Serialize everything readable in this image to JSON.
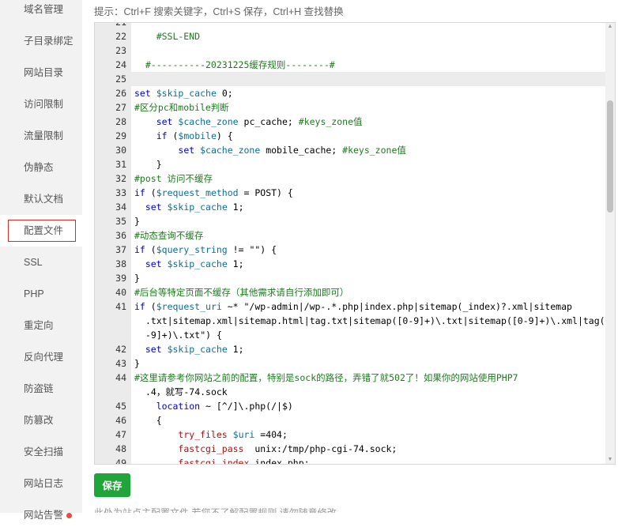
{
  "sidebar": {
    "items": [
      {
        "label": "域名管理"
      },
      {
        "label": "子目录绑定"
      },
      {
        "label": "网站目录"
      },
      {
        "label": "访问限制"
      },
      {
        "label": "流量限制"
      },
      {
        "label": "伪静态"
      },
      {
        "label": "默认文档"
      },
      {
        "label": "配置文件",
        "active": true
      },
      {
        "label": "SSL"
      },
      {
        "label": "PHP"
      },
      {
        "label": "重定向"
      },
      {
        "label": "反向代理"
      },
      {
        "label": "防盗链"
      },
      {
        "label": "防篡改"
      },
      {
        "label": "安全扫描"
      },
      {
        "label": "网站日志"
      },
      {
        "label": "网站告警"
      }
    ]
  },
  "tip": "提示：Ctrl+F 搜索关键字，Ctrl+S 保存，Ctrl+H 查找替换",
  "editor": {
    "lines": [
      {
        "n": "21",
        "text": ""
      },
      {
        "n": "22",
        "text": "    #SSL-END"
      },
      {
        "n": "23",
        "text": ""
      },
      {
        "n": "24",
        "text": "  #----------20231225缓存规则--------#"
      },
      {
        "n": "25",
        "text": "",
        "highlight": true
      },
      {
        "n": "26",
        "text": "set $skip_cache 0;"
      },
      {
        "n": "27",
        "text": "#区分pc和mobile判断"
      },
      {
        "n": "28",
        "text": "    set $cache_zone pc_cache; #keys_zone值"
      },
      {
        "n": "29",
        "text": "    if ($mobile) {"
      },
      {
        "n": "30",
        "text": "        set $cache_zone mobile_cache; #keys_zone值"
      },
      {
        "n": "31",
        "text": "    }"
      },
      {
        "n": "32",
        "text": "#post 访问不缓存"
      },
      {
        "n": "33",
        "text": "if ($request_method = POST) {"
      },
      {
        "n": "34",
        "text": "  set $skip_cache 1;"
      },
      {
        "n": "35",
        "text": "}"
      },
      {
        "n": "36",
        "text": "#动态查询不缓存"
      },
      {
        "n": "37",
        "text": "if ($query_string != \"\") {"
      },
      {
        "n": "38",
        "text": "  set $skip_cache 1;"
      },
      {
        "n": "39",
        "text": "}"
      },
      {
        "n": "40",
        "text": "#后台等特定页面不缓存（其他需求请自行添加即可）"
      },
      {
        "n": "41",
        "text": "if ($request_uri ~* \"/wp-admin|/wp-.*.php|index.php|sitemap(_index)?.xml|sitemap"
      },
      {
        "n": "",
        "text": ".txt|sitemap.xml|sitemap.html|tag.txt|sitemap([0-9]+)\\.txt|sitemap([0-9]+)\\.xml|tag([0",
        "cont": true
      },
      {
        "n": "",
        "text": "-9]+)\\.txt\") {",
        "cont": true
      },
      {
        "n": "42",
        "text": "  set $skip_cache 1;"
      },
      {
        "n": "43",
        "text": "}"
      },
      {
        "n": "44",
        "text": "#这里请参考你网站之前的配置，特别是sock的路径，弄错了就502了！如果你的网站使用PHP7"
      },
      {
        "n": "",
        "text": ".4，就写-74.sock",
        "cont": true
      },
      {
        "n": "45",
        "text": "    location ~ [^/]\\.php(/|$)"
      },
      {
        "n": "46",
        "text": "    {"
      },
      {
        "n": "47",
        "text": "        try_files $uri =404;"
      },
      {
        "n": "48",
        "text": "        fastcgi_pass  unix:/tmp/php-cgi-74.sock;"
      },
      {
        "n": "49",
        "text": "        fastcgi_index index.php;"
      }
    ]
  },
  "save_button": "保存",
  "bottom_note": "此处为站点主配置文件,若您不了解配置规则,请勿随意修改."
}
